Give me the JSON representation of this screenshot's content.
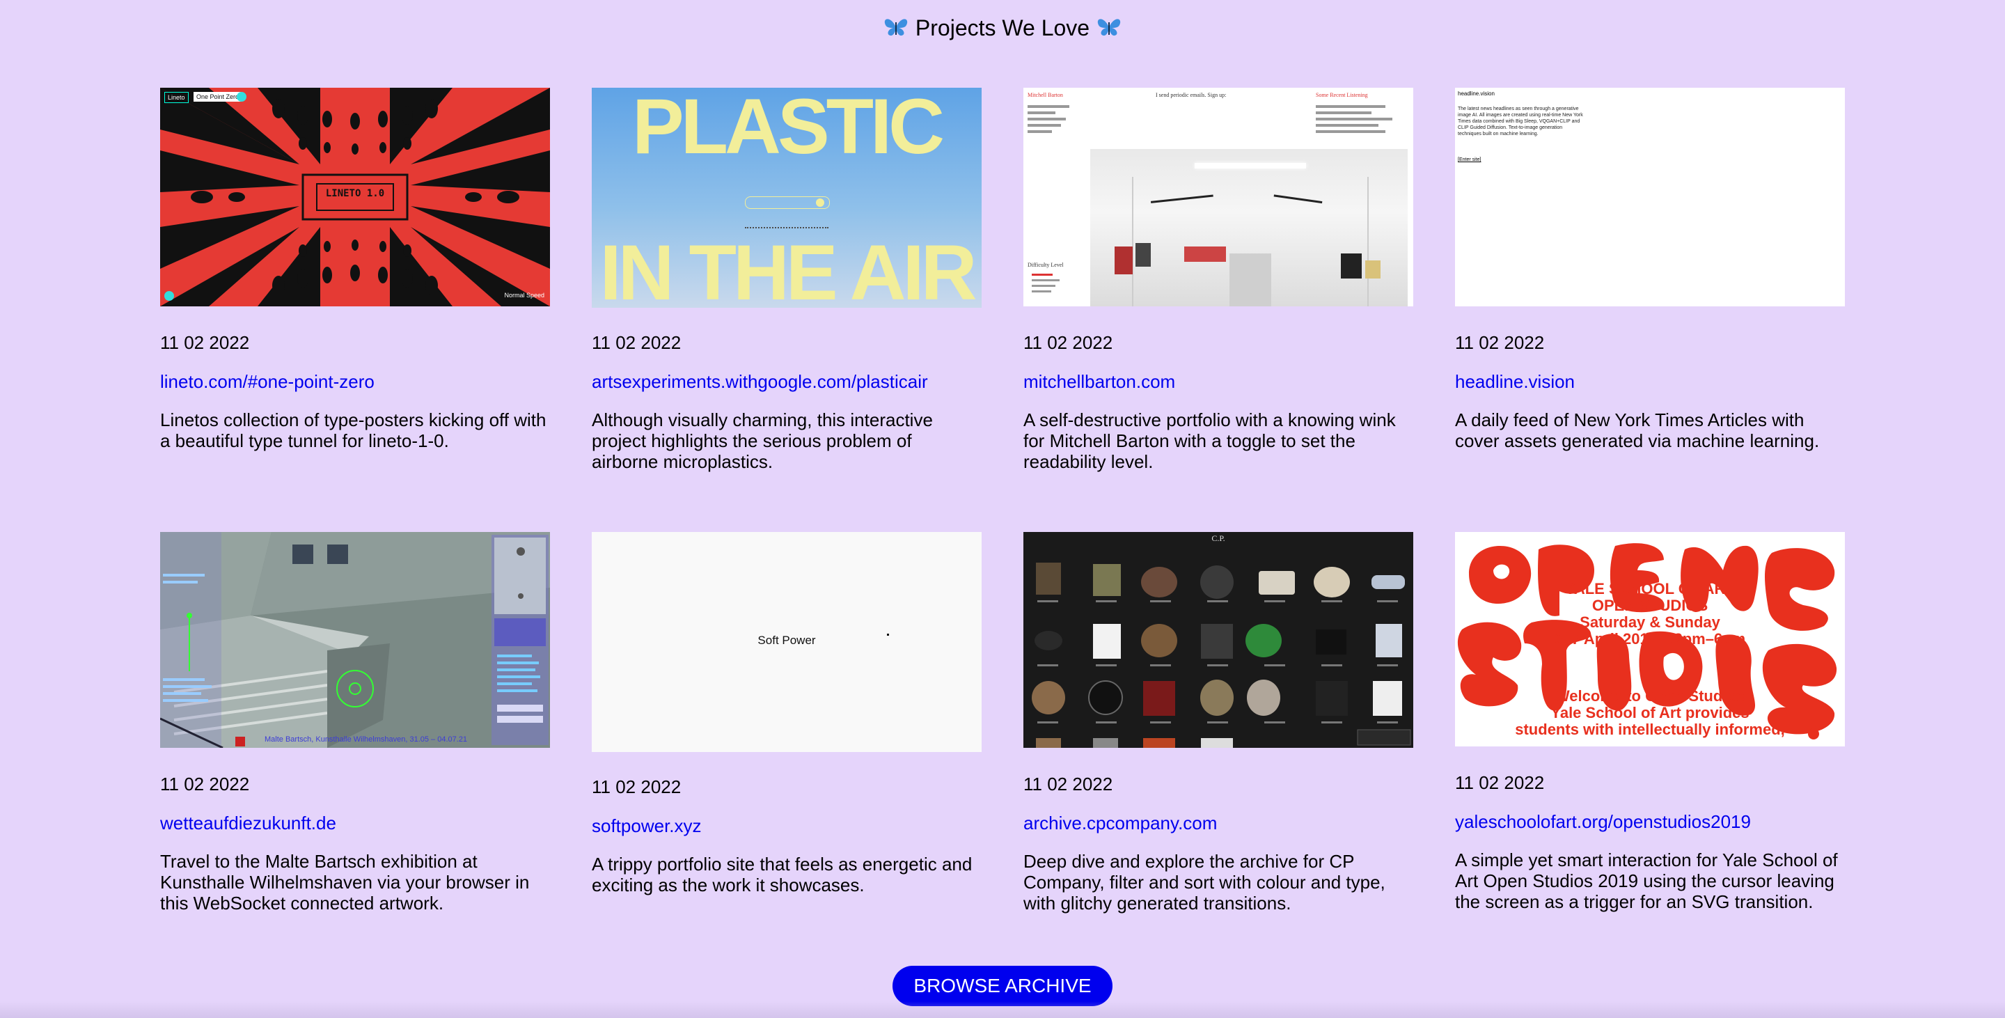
{
  "page": {
    "title": "Projects We Love",
    "title_icon": "butterfly-icon"
  },
  "colors": {
    "background": "#e5d4fb",
    "link": "#0000ee",
    "button": "#0000ee",
    "button_text": "#ffffff"
  },
  "projects": [
    {
      "date": "11 02 2022",
      "link": "lineto.com/#one-point-zero",
      "description": "Linetos collection of type-posters kicking off with a beautiful type tunnel for lineto-1-0.",
      "thumb": {
        "tag1": "Lineto",
        "tag2": "One Point Zero",
        "center": "LINETO 1.0",
        "corner": "Normal Speed"
      }
    },
    {
      "date": "11 02 2022",
      "link": "artsexperiments.withgoogle.com/plasticair",
      "description": "Although visually charming, this interactive project highlights the serious problem of airborne microplastics.",
      "thumb": {
        "line1": "PLASTIC",
        "line2": "IN THE AIR"
      }
    },
    {
      "date": "11 02 2022",
      "link": "mitchellbarton.com",
      "description": "A self-destructive portfolio with a knowing wink for Mitchell Barton with a toggle to set the readability level.",
      "thumb": {
        "name": "Mitchell Barton",
        "tagline": "I send periodic emails. Sign up:",
        "section": "Some Recent Listening",
        "difficulty": "Difficulty Level"
      }
    },
    {
      "date": "11 02 2022",
      "link": "headline.vision",
      "description": "A daily feed of New York Times Articles with cover assets generated via machine learning.",
      "thumb": {
        "heading": "headline.vision",
        "body": "The latest news headlines as seen through a generative image AI. All images are created using real-time New York Times data combined with Big Sleep, VQGAN+CLIP and CLIP Guided Diffusion. Text-to-image generation techniques built on machine learning.",
        "enter": "[Enter site]"
      }
    },
    {
      "date": "11 02 2022",
      "link": "wetteaufdiezukunft.de",
      "description": "Travel to the Malte Bartsch exhibition at Kunsthalle Wilhelmshaven via your browser in this WebSocket connected artwork.",
      "thumb": {
        "caption": "Malte Bartsch, Kunsthalle Wilhelmshaven, 31.05 – 04.07.21"
      }
    },
    {
      "date": "11 02 2022",
      "link": "softpower.xyz",
      "description": "A trippy portfolio site that feels as energetic and exciting as the work it showcases.",
      "thumb": {
        "center": "Soft Power"
      }
    },
    {
      "date": "11 02 2022",
      "link": "archive.cpcompany.com",
      "description": "Deep dive and explore the archive for CP Company, filter and sort with colour and type, with glitchy generated transitions.",
      "thumb": {
        "logo": "C.P."
      }
    },
    {
      "date": "11 02 2022",
      "link": "yaleschoolofart.org/openstudios2019",
      "description": "A simple yet smart interaction for Yale School of Art Open Studios 2019 using the cursor leaving the screen as a trigger for an SVG transition.",
      "thumb": {
        "line1": "YALE SCHOOL OF ART",
        "line2": "OPEN STUDIOS",
        "line3": "Saturday & Sunday",
        "line4": "6–7 April 2019, 12pm–6pm",
        "line5": "Welcome to Open Studios",
        "line6": "Yale School of Art provides",
        "line7": "students with intellectually informed,"
      }
    }
  ],
  "browse_button": "BROWSE ARCHIVE"
}
